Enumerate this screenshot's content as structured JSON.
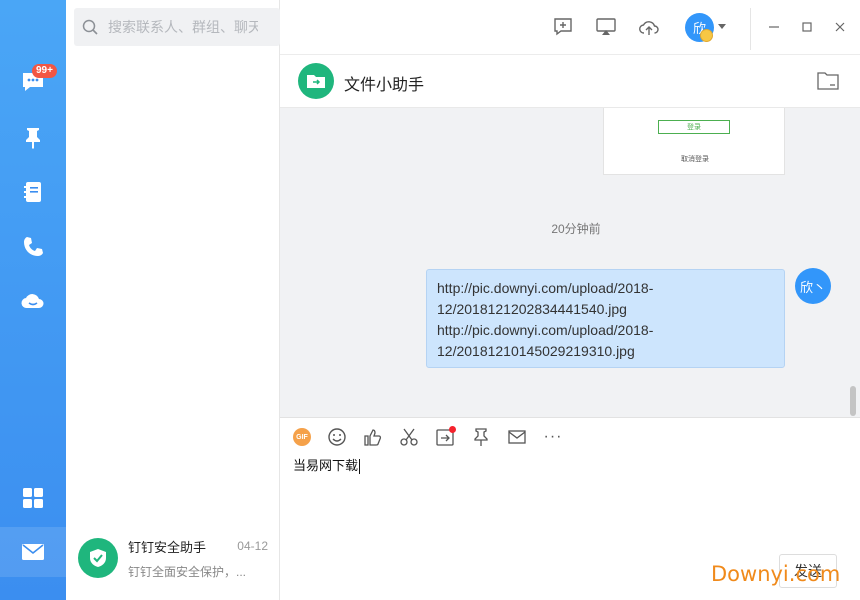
{
  "sidebar": {
    "badge": "99+",
    "items": [
      {
        "icon": "chat-icon"
      },
      {
        "icon": "pin-icon"
      },
      {
        "icon": "contacts-book-icon"
      },
      {
        "icon": "phone-icon"
      },
      {
        "icon": "cloud-icon"
      },
      {
        "icon": "apps-grid-icon"
      },
      {
        "icon": "mail-icon"
      }
    ]
  },
  "search": {
    "placeholder": "搜索联系人、群组、聊天"
  },
  "conversations": [
    {
      "name": "钉钉安全助手",
      "date": "04-12",
      "preview": "钉钉全面安全保护，..."
    }
  ],
  "user": {
    "avatar_text": "欣"
  },
  "chat": {
    "title": "文件小助手",
    "image_preview": {
      "button_label": "登录",
      "cancel_label": "取消登录"
    },
    "timestamp": "20分钟前",
    "message": "http://pic.downyi.com/upload/2018-12/20181212028344415​40.jpg http://pic.downyi.com/upload/2018-12/20181210145029219310.jpg",
    "message_lines": [
      "http://pic.downyi.com/upload/2018-",
      "12/20181212028344415​40.jpg",
      "http://pic.downyi.com/upload/2018-",
      "12/20181210145029219310.jpg"
    ],
    "message_avatar_text": "欣丶"
  },
  "composer": {
    "gif_label": "GIF",
    "draft": "当易网下载",
    "send_label": "发送",
    "more_label": "···"
  },
  "watermark": "Downyi.com",
  "colors": {
    "nav_blue": "#3b8ef0",
    "accent_green": "#1fb67d",
    "bubble": "#cde5fd",
    "badge_red": "#f25643",
    "watermark_orange": "#f08a1b"
  }
}
